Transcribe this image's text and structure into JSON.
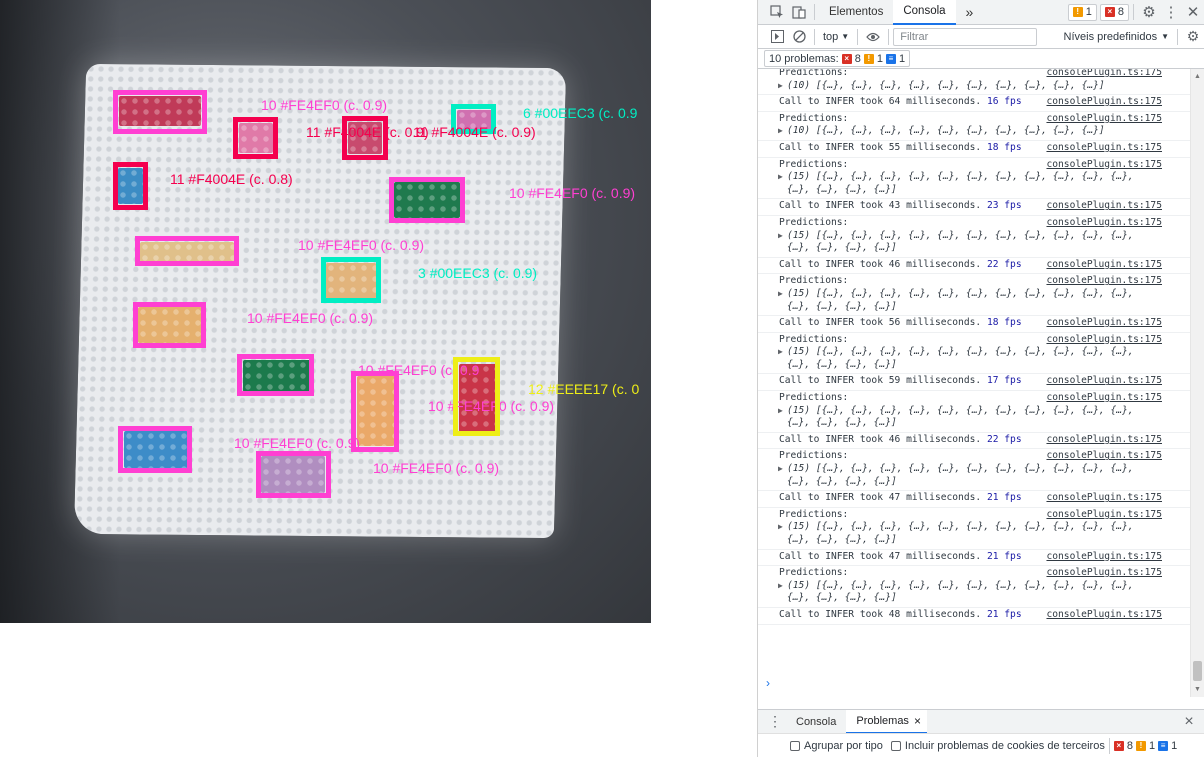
{
  "camera": {
    "bricks": [
      {
        "color": "#c03a58"
      },
      {
        "color": "#e07aa8"
      },
      {
        "color": "#c84a6e"
      },
      {
        "color": "#d070b0"
      },
      {
        "color": "#3c8cc4"
      },
      {
        "color": "#1f7a4e"
      },
      {
        "color": "#e0c08a"
      },
      {
        "color": "#e2b47c"
      },
      {
        "color": "#e5b06e"
      },
      {
        "color": "#1c7a4c"
      },
      {
        "color": "#eaa868"
      },
      {
        "color": "#c93448"
      },
      {
        "color": "#3d8cc8"
      },
      {
        "color": "#b08ec0"
      }
    ],
    "detections": [
      {
        "box_color": "#ff3fd2",
        "label": "",
        "label_color": "#ff3fd2"
      },
      {
        "box_color": "#f4004e",
        "label": "",
        "label_color": "#f4004e"
      },
      {
        "box_color": "#f4004e",
        "label": "11 #F4004E (c. 0.9)",
        "label_color": "#f4004e"
      },
      {
        "box_color": "#00eec3",
        "label": "6 #00EEC3 (c. 0.9",
        "label_color": "#00eec3"
      },
      {
        "box_color": "#f4004e",
        "label": "11 #F4004E (c. 0.8)",
        "label_color": "#f4004e"
      },
      {
        "box_color": "#ff3fd2",
        "label": "10 #FE4EF0 (c. 0.9)",
        "label_color": "#ff3fd2"
      },
      {
        "box_color": "#ff3fd2",
        "label": "10 #FE4EF0 (c. 0.9)",
        "label_color": "#ff3fd2"
      },
      {
        "box_color": "#00eec3",
        "label": "3 #00EEC3 (c. 0.9)",
        "label_color": "#00eec3"
      },
      {
        "box_color": "#ff3fd2",
        "label": "10 #FE4EF0 (c. 0.9)",
        "label_color": "#ff3fd2"
      },
      {
        "box_color": "#ff3fd2",
        "label": "10 #FE4EF0 (c. 0.9",
        "label_color": "#ff3fd2"
      },
      {
        "box_color": "#ff3fd2",
        "label": "10 #FE4EF0 (c. 0.9)",
        "label_color": "#ff3fd2"
      },
      {
        "box_color": "#eeee17",
        "label": "12 #EEEE17 (c. 0",
        "label_color": "#eeee17"
      },
      {
        "box_color": "#ff3fd2",
        "label": "10 #FE4EF0 (c. 0.9)",
        "label_color": "#ff3fd2"
      },
      {
        "box_color": "#ff3fd2",
        "label": "10 #FE4EF0 (c. 0.9)",
        "label_color": "#ff3fd2"
      }
    ],
    "extra_labels": [
      {
        "text": "10 #FE4EF0 (c. 0.9)",
        "color": "#ff3fd2"
      },
      {
        "text": "11 #F4004E (c. 0.9)",
        "color": "#f4004e"
      }
    ]
  },
  "devtools": {
    "tabs": [
      "Elementos",
      "Consola"
    ],
    "more_tabs": "»",
    "warning_count": "1",
    "error_count": "8",
    "context": "top",
    "filter_placeholder": "Filtrar",
    "levels": "Níveis predefinidos",
    "issues": {
      "label": "10 problemas:",
      "errors": "8",
      "warnings": "1",
      "info": "1"
    },
    "messages": [
      {
        "kind": "pred",
        "lines": [
          "Predictions:",
          "(10) [{…}, {…}, {…}, {…}, {…}, {…}, {…}, {…}, {…}, {…}]"
        ],
        "source": "consolePlugin.ts:175",
        "partial": true
      },
      {
        "kind": "timing",
        "text": "Call to INFER took 64 milliseconds.",
        "fps": "16 fps",
        "source": "consolePlugin.ts:175"
      },
      {
        "kind": "pred",
        "lines": [
          "Predictions:",
          "(10) [{…}, {…}, {…}, {…}, {…}, {…}, {…}, {…}, {…}, {…}]"
        ],
        "source": "consolePlugin.ts:175"
      },
      {
        "kind": "timing",
        "text": "Call to INFER took 55 milliseconds.",
        "fps": "18 fps",
        "source": "consolePlugin.ts:175"
      },
      {
        "kind": "pred",
        "lines": [
          "Predictions:",
          "(15) [{…}, {…}, {…}, {…}, {…}, {…}, {…}, {…}, {…}, {…}, {…},",
          "{…}, {…}, {…}, {…}]"
        ],
        "source": "consolePlugin.ts:175"
      },
      {
        "kind": "timing",
        "text": "Call to INFER took 43 milliseconds.",
        "fps": "23 fps",
        "source": "consolePlugin.ts:175"
      },
      {
        "kind": "pred",
        "lines": [
          "Predictions:",
          "(15) [{…}, {…}, {…}, {…}, {…}, {…}, {…}, {…}, {…}, {…}, {…},",
          "{…}, {…}, {…}, {…}]"
        ],
        "source": "consolePlugin.ts:175"
      },
      {
        "kind": "timing",
        "text": "Call to INFER took 46 milliseconds.",
        "fps": "22 fps",
        "source": "consolePlugin.ts:175"
      },
      {
        "kind": "pred",
        "lines": [
          "Predictions:",
          "(15) [{…}, {…}, {…}, {…}, {…}, {…}, {…}, {…}, {…}, {…}, {…},",
          "{…}, {…}, {…}, {…}]"
        ],
        "source": "consolePlugin.ts:175"
      },
      {
        "kind": "timing",
        "text": "Call to INFER took 56 milliseconds.",
        "fps": "18 fps",
        "source": "consolePlugin.ts:175"
      },
      {
        "kind": "pred",
        "lines": [
          "Predictions:",
          "(15) [{…}, {…}, {…}, {…}, {…}, {…}, {…}, {…}, {…}, {…}, {…},",
          "{…}, {…}, {…}, {…}]"
        ],
        "source": "consolePlugin.ts:175"
      },
      {
        "kind": "timing",
        "text": "Call to INFER took 59 milliseconds.",
        "fps": "17 fps",
        "source": "consolePlugin.ts:175"
      },
      {
        "kind": "pred",
        "lines": [
          "Predictions:",
          "(15) [{…}, {…}, {…}, {…}, {…}, {…}, {…}, {…}, {…}, {…}, {…},",
          "{…}, {…}, {…}, {…}]"
        ],
        "source": "consolePlugin.ts:175"
      },
      {
        "kind": "timing",
        "text": "Call to INFER took 46 milliseconds.",
        "fps": "22 fps",
        "source": "consolePlugin.ts:175"
      },
      {
        "kind": "pred",
        "lines": [
          "Predictions:",
          "(15) [{…}, {…}, {…}, {…}, {…}, {…}, {…}, {…}, {…}, {…}, {…},",
          "{…}, {…}, {…}, {…}]"
        ],
        "source": "consolePlugin.ts:175"
      },
      {
        "kind": "timing",
        "text": "Call to INFER took 47 milliseconds.",
        "fps": "21 fps",
        "source": "consolePlugin.ts:175"
      },
      {
        "kind": "pred",
        "lines": [
          "Predictions:",
          "(15) [{…}, {…}, {…}, {…}, {…}, {…}, {…}, {…}, {…}, {…}, {…},",
          "{…}, {…}, {…}, {…}]"
        ],
        "source": "consolePlugin.ts:175"
      },
      {
        "kind": "timing",
        "text": "Call to INFER took 47 milliseconds.",
        "fps": "21 fps",
        "source": "consolePlugin.ts:175"
      },
      {
        "kind": "pred",
        "lines": [
          "Predictions:",
          "(15) [{…}, {…}, {…}, {…}, {…}, {…}, {…}, {…}, {…}, {…}, {…},",
          "{…}, {…}, {…}, {…}]"
        ],
        "source": "consolePlugin.ts:175"
      },
      {
        "kind": "timing",
        "text": "Call to INFER took 48 milliseconds.",
        "fps": "21 fps",
        "source": "consolePlugin.ts:175"
      }
    ],
    "prompt": "›",
    "drawer": {
      "tabs": [
        "Consola",
        "Problemas"
      ],
      "close": "×",
      "group_by_type": "Agrupar por tipo",
      "include_third_party": "Incluir problemas de cookies de terceiros",
      "errors": "8",
      "warnings": "1",
      "info": "1"
    }
  }
}
